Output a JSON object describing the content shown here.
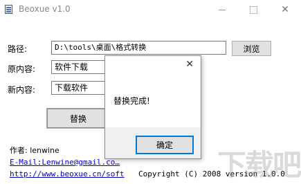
{
  "window": {
    "title": "Beoxue v1.0"
  },
  "form": {
    "path_label": "路径:",
    "path_value": "D:\\tools\\桌面\\格式转换",
    "browse_label": "浏览",
    "original_label": "原内容:",
    "original_value": "软件下载",
    "new_label": "新内容:",
    "new_value": "下载软件",
    "replace_label": "替换"
  },
  "footer": {
    "author": "作者: lenwine",
    "email": "E-Mail:Lenwine@gmail.co…",
    "website": "http://www.beoxue.cn/soft",
    "copyright": "Copyright (C) 2008 version 1.0.0"
  },
  "dialog": {
    "message": "替换完成!",
    "ok_label": "确定"
  },
  "watermark": "下载吧"
}
